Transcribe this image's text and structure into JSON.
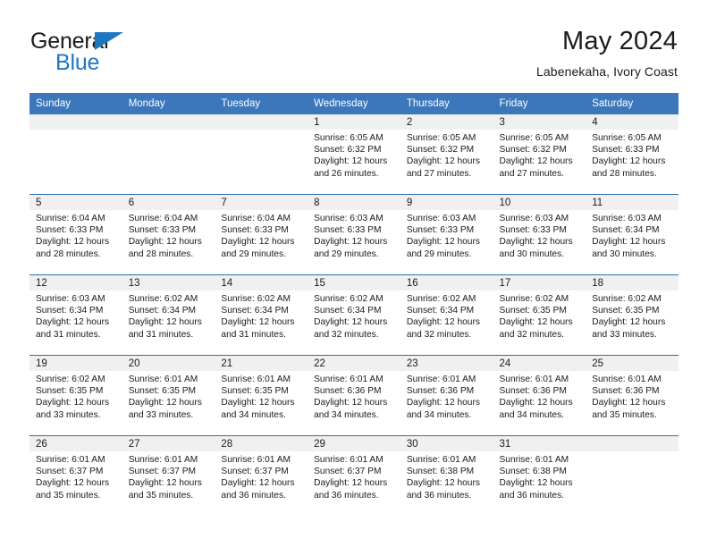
{
  "brand": {
    "name_primary": "General",
    "name_secondary": "Blue",
    "triangle_color": "#1f77c2"
  },
  "header": {
    "title": "May 2024",
    "subtitle": "Labenekaha, Ivory Coast"
  },
  "theme": {
    "header_bg": "#3b77ba",
    "row_divider": "#2e6fb0",
    "daynum_bg": "#f0f0f0",
    "text": "#1b1b1b"
  },
  "weekday_headers": [
    "Sunday",
    "Monday",
    "Tuesday",
    "Wednesday",
    "Thursday",
    "Friday",
    "Saturday"
  ],
  "weeks": [
    [
      {
        "day": "",
        "empty": true,
        "sunrise": "",
        "sunset": "",
        "daylight_line1": "",
        "daylight_line2": ""
      },
      {
        "day": "",
        "empty": true,
        "sunrise": "",
        "sunset": "",
        "daylight_line1": "",
        "daylight_line2": ""
      },
      {
        "day": "",
        "empty": true,
        "sunrise": "",
        "sunset": "",
        "daylight_line1": "",
        "daylight_line2": ""
      },
      {
        "day": "1",
        "empty": false,
        "sunrise": "Sunrise: 6:05 AM",
        "sunset": "Sunset: 6:32 PM",
        "daylight_line1": "Daylight: 12 hours",
        "daylight_line2": "and 26 minutes."
      },
      {
        "day": "2",
        "empty": false,
        "sunrise": "Sunrise: 6:05 AM",
        "sunset": "Sunset: 6:32 PM",
        "daylight_line1": "Daylight: 12 hours",
        "daylight_line2": "and 27 minutes."
      },
      {
        "day": "3",
        "empty": false,
        "sunrise": "Sunrise: 6:05 AM",
        "sunset": "Sunset: 6:32 PM",
        "daylight_line1": "Daylight: 12 hours",
        "daylight_line2": "and 27 minutes."
      },
      {
        "day": "4",
        "empty": false,
        "sunrise": "Sunrise: 6:05 AM",
        "sunset": "Sunset: 6:33 PM",
        "daylight_line1": "Daylight: 12 hours",
        "daylight_line2": "and 28 minutes."
      }
    ],
    [
      {
        "day": "5",
        "empty": false,
        "sunrise": "Sunrise: 6:04 AM",
        "sunset": "Sunset: 6:33 PM",
        "daylight_line1": "Daylight: 12 hours",
        "daylight_line2": "and 28 minutes."
      },
      {
        "day": "6",
        "empty": false,
        "sunrise": "Sunrise: 6:04 AM",
        "sunset": "Sunset: 6:33 PM",
        "daylight_line1": "Daylight: 12 hours",
        "daylight_line2": "and 28 minutes."
      },
      {
        "day": "7",
        "empty": false,
        "sunrise": "Sunrise: 6:04 AM",
        "sunset": "Sunset: 6:33 PM",
        "daylight_line1": "Daylight: 12 hours",
        "daylight_line2": "and 29 minutes."
      },
      {
        "day": "8",
        "empty": false,
        "sunrise": "Sunrise: 6:03 AM",
        "sunset": "Sunset: 6:33 PM",
        "daylight_line1": "Daylight: 12 hours",
        "daylight_line2": "and 29 minutes."
      },
      {
        "day": "9",
        "empty": false,
        "sunrise": "Sunrise: 6:03 AM",
        "sunset": "Sunset: 6:33 PM",
        "daylight_line1": "Daylight: 12 hours",
        "daylight_line2": "and 29 minutes."
      },
      {
        "day": "10",
        "empty": false,
        "sunrise": "Sunrise: 6:03 AM",
        "sunset": "Sunset: 6:33 PM",
        "daylight_line1": "Daylight: 12 hours",
        "daylight_line2": "and 30 minutes."
      },
      {
        "day": "11",
        "empty": false,
        "sunrise": "Sunrise: 6:03 AM",
        "sunset": "Sunset: 6:34 PM",
        "daylight_line1": "Daylight: 12 hours",
        "daylight_line2": "and 30 minutes."
      }
    ],
    [
      {
        "day": "12",
        "empty": false,
        "sunrise": "Sunrise: 6:03 AM",
        "sunset": "Sunset: 6:34 PM",
        "daylight_line1": "Daylight: 12 hours",
        "daylight_line2": "and 31 minutes."
      },
      {
        "day": "13",
        "empty": false,
        "sunrise": "Sunrise: 6:02 AM",
        "sunset": "Sunset: 6:34 PM",
        "daylight_line1": "Daylight: 12 hours",
        "daylight_line2": "and 31 minutes."
      },
      {
        "day": "14",
        "empty": false,
        "sunrise": "Sunrise: 6:02 AM",
        "sunset": "Sunset: 6:34 PM",
        "daylight_line1": "Daylight: 12 hours",
        "daylight_line2": "and 31 minutes."
      },
      {
        "day": "15",
        "empty": false,
        "sunrise": "Sunrise: 6:02 AM",
        "sunset": "Sunset: 6:34 PM",
        "daylight_line1": "Daylight: 12 hours",
        "daylight_line2": "and 32 minutes."
      },
      {
        "day": "16",
        "empty": false,
        "sunrise": "Sunrise: 6:02 AM",
        "sunset": "Sunset: 6:34 PM",
        "daylight_line1": "Daylight: 12 hours",
        "daylight_line2": "and 32 minutes."
      },
      {
        "day": "17",
        "empty": false,
        "sunrise": "Sunrise: 6:02 AM",
        "sunset": "Sunset: 6:35 PM",
        "daylight_line1": "Daylight: 12 hours",
        "daylight_line2": "and 32 minutes."
      },
      {
        "day": "18",
        "empty": false,
        "sunrise": "Sunrise: 6:02 AM",
        "sunset": "Sunset: 6:35 PM",
        "daylight_line1": "Daylight: 12 hours",
        "daylight_line2": "and 33 minutes."
      }
    ],
    [
      {
        "day": "19",
        "empty": false,
        "sunrise": "Sunrise: 6:02 AM",
        "sunset": "Sunset: 6:35 PM",
        "daylight_line1": "Daylight: 12 hours",
        "daylight_line2": "and 33 minutes."
      },
      {
        "day": "20",
        "empty": false,
        "sunrise": "Sunrise: 6:01 AM",
        "sunset": "Sunset: 6:35 PM",
        "daylight_line1": "Daylight: 12 hours",
        "daylight_line2": "and 33 minutes."
      },
      {
        "day": "21",
        "empty": false,
        "sunrise": "Sunrise: 6:01 AM",
        "sunset": "Sunset: 6:35 PM",
        "daylight_line1": "Daylight: 12 hours",
        "daylight_line2": "and 34 minutes."
      },
      {
        "day": "22",
        "empty": false,
        "sunrise": "Sunrise: 6:01 AM",
        "sunset": "Sunset: 6:36 PM",
        "daylight_line1": "Daylight: 12 hours",
        "daylight_line2": "and 34 minutes."
      },
      {
        "day": "23",
        "empty": false,
        "sunrise": "Sunrise: 6:01 AM",
        "sunset": "Sunset: 6:36 PM",
        "daylight_line1": "Daylight: 12 hours",
        "daylight_line2": "and 34 minutes."
      },
      {
        "day": "24",
        "empty": false,
        "sunrise": "Sunrise: 6:01 AM",
        "sunset": "Sunset: 6:36 PM",
        "daylight_line1": "Daylight: 12 hours",
        "daylight_line2": "and 34 minutes."
      },
      {
        "day": "25",
        "empty": false,
        "sunrise": "Sunrise: 6:01 AM",
        "sunset": "Sunset: 6:36 PM",
        "daylight_line1": "Daylight: 12 hours",
        "daylight_line2": "and 35 minutes."
      }
    ],
    [
      {
        "day": "26",
        "empty": false,
        "sunrise": "Sunrise: 6:01 AM",
        "sunset": "Sunset: 6:37 PM",
        "daylight_line1": "Daylight: 12 hours",
        "daylight_line2": "and 35 minutes."
      },
      {
        "day": "27",
        "empty": false,
        "sunrise": "Sunrise: 6:01 AM",
        "sunset": "Sunset: 6:37 PM",
        "daylight_line1": "Daylight: 12 hours",
        "daylight_line2": "and 35 minutes."
      },
      {
        "day": "28",
        "empty": false,
        "sunrise": "Sunrise: 6:01 AM",
        "sunset": "Sunset: 6:37 PM",
        "daylight_line1": "Daylight: 12 hours",
        "daylight_line2": "and 36 minutes."
      },
      {
        "day": "29",
        "empty": false,
        "sunrise": "Sunrise: 6:01 AM",
        "sunset": "Sunset: 6:37 PM",
        "daylight_line1": "Daylight: 12 hours",
        "daylight_line2": "and 36 minutes."
      },
      {
        "day": "30",
        "empty": false,
        "sunrise": "Sunrise: 6:01 AM",
        "sunset": "Sunset: 6:38 PM",
        "daylight_line1": "Daylight: 12 hours",
        "daylight_line2": "and 36 minutes."
      },
      {
        "day": "31",
        "empty": false,
        "sunrise": "Sunrise: 6:01 AM",
        "sunset": "Sunset: 6:38 PM",
        "daylight_line1": "Daylight: 12 hours",
        "daylight_line2": "and 36 minutes."
      },
      {
        "day": "",
        "empty": true,
        "sunrise": "",
        "sunset": "",
        "daylight_line1": "",
        "daylight_line2": ""
      }
    ]
  ]
}
